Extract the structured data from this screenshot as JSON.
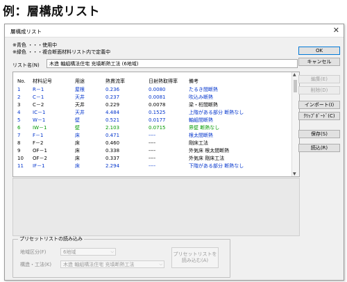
{
  "heading": "例：層構成リスト",
  "dialog": {
    "title": "層構成リスト",
    "close_glyph": "✕",
    "legend_line1": "※青色 ・・・使用中",
    "legend_line2": "※緑色 ・・・複合断面材料リスト内で定義中",
    "list_name_label": "リスト名(N)",
    "list_name_value": "木造 軸組構法住宅 充填断熱工法 (6地域)"
  },
  "table": {
    "headers": {
      "no": "No.",
      "code": "材料記号",
      "use": "用途",
      "cond": "熱貫流率",
      "ratio": "日射熱取得率",
      "note": "備考"
    },
    "rows": [
      {
        "no": "1",
        "code": "R－1",
        "use": "屋根",
        "cond": "0.236",
        "ratio": "0.0080",
        "note": "たるき間断熱",
        "color": "blue"
      },
      {
        "no": "2",
        "code": "C－1",
        "use": "天井",
        "cond": "0.237",
        "ratio": "0.0081",
        "note": "吹込み断熱",
        "color": "blue"
      },
      {
        "no": "3",
        "code": "C－2",
        "use": "天井",
        "cond": "0.229",
        "ratio": "0.0078",
        "note": "梁・桁間断熱",
        "color": "black"
      },
      {
        "no": "4",
        "code": "IC－1",
        "use": "天井",
        "cond": "4.484",
        "ratio": "0.1525",
        "note": "上階がある部分 断熱なし",
        "color": "blue"
      },
      {
        "no": "5",
        "code": "W－1",
        "use": "壁",
        "cond": "0.521",
        "ratio": "0.0177",
        "note": "軸組間断熱",
        "color": "blue"
      },
      {
        "no": "6",
        "code": "IW－1",
        "use": "壁",
        "cond": "2.103",
        "ratio": "0.0715",
        "note": "界壁 断熱なし",
        "color": "green"
      },
      {
        "no": "7",
        "code": "F－1",
        "use": "床",
        "cond": "0.471",
        "ratio": "----",
        "note": "根太間断熱",
        "color": "blue"
      },
      {
        "no": "8",
        "code": "F－2",
        "use": "床",
        "cond": "0.460",
        "ratio": "----",
        "note": "剛床工法",
        "color": "black"
      },
      {
        "no": "9",
        "code": "OF－1",
        "use": "床",
        "cond": "0.338",
        "ratio": "----",
        "note": "外気床 根太間断熱",
        "color": "black"
      },
      {
        "no": "10",
        "code": "OF－2",
        "use": "床",
        "cond": "0.337",
        "ratio": "----",
        "note": "外気床 剛床工法",
        "color": "black"
      },
      {
        "no": "11",
        "code": "IF－1",
        "use": "床",
        "cond": "2.294",
        "ratio": "----",
        "note": "下階がある部分 断熱なし",
        "color": "blue"
      }
    ]
  },
  "buttons": {
    "ok": "OK",
    "cancel": "キャンセル",
    "edit": "編集(E)",
    "delete": "削除(D)",
    "import": "インポート(I)",
    "clipboard": "ｸﾘｯﾌﾟﾎﾞｰﾄﾞ(C)",
    "save": "保存(S)",
    "load": "読込(R)"
  },
  "preset": {
    "title": "プリセットリストの読み込み",
    "region_label": "地域区分(F)",
    "region_value": "6地域",
    "spec_label": "構造・工法(K)",
    "spec_value": "木造 軸組構法住宅 充填断熱工法",
    "preset_button_line1": "プリセットリストを",
    "preset_button_line2": "読み込む(A)",
    "dropdown_glyph": "⌵"
  },
  "scrollbar": {
    "up_glyph": "▲",
    "down_glyph": "▼"
  },
  "colors": {
    "blue": "#0033cc",
    "green": "#009900",
    "black": "#000000"
  }
}
